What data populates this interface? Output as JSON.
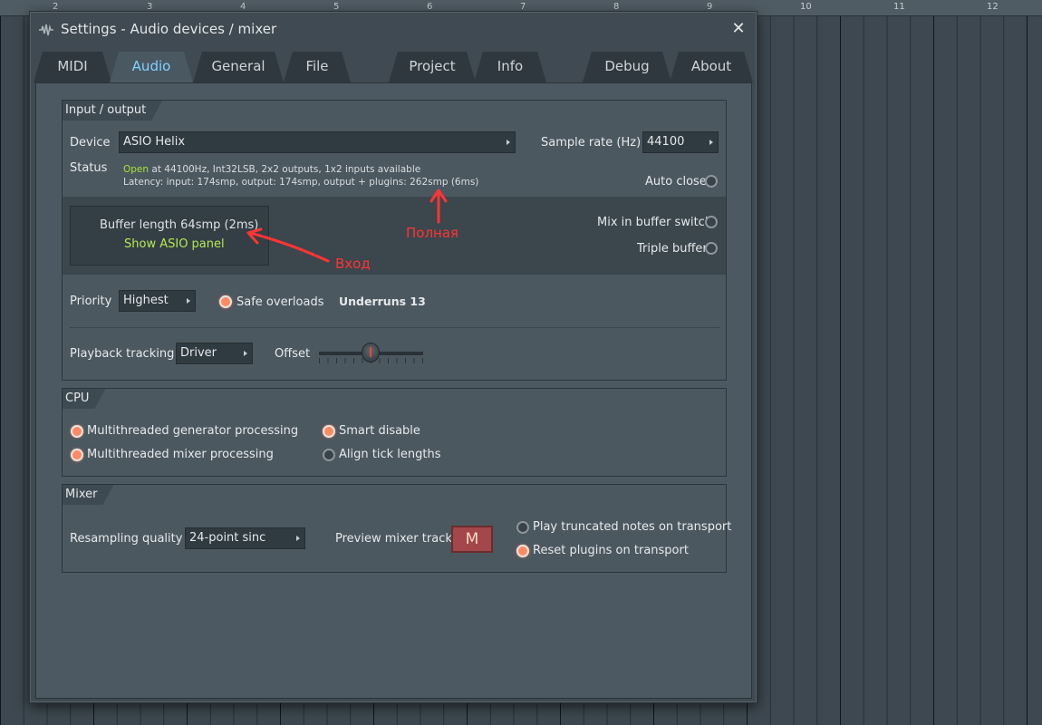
{
  "ruler": {
    "marks": [
      "2",
      "3",
      "4",
      "5",
      "6",
      "7",
      "8",
      "9",
      "10",
      "11",
      "12"
    ]
  },
  "window": {
    "title": "Settings - Audio devices / mixer",
    "close": "✕"
  },
  "tabs": [
    {
      "label": "MIDI"
    },
    {
      "label": "Audio",
      "active": true
    },
    {
      "label": "General"
    },
    {
      "label": "File"
    },
    {
      "label": "Project"
    },
    {
      "label": "Info"
    },
    {
      "label": "Debug"
    },
    {
      "label": "About"
    }
  ],
  "io": {
    "title": "Input / output",
    "device_label": "Device",
    "device_value": "ASIO Helix",
    "sample_rate_label": "Sample rate (Hz)",
    "sample_rate_value": "44100",
    "status_label": "Status",
    "status_open": "Open",
    "status_line1": " at 44100Hz, Int32LSB, 2x2 outputs, 1x2 inputs available",
    "status_line2": "Latency: input: 174smp, output: 174smp, output + plugins: 262smp (6ms)",
    "auto_close": "Auto close",
    "buffer_length": "Buffer length 64smp (2ms)",
    "show_asio": "Show ASIO panel",
    "mix_in_buffer": "Mix in buffer switch",
    "triple_buffer": "Triple buffer",
    "priority_label": "Priority",
    "priority_value": "Highest",
    "safe_overloads": "Safe overloads",
    "underruns": "Underruns 13",
    "playback_label": "Playback tracking",
    "playback_value": "Driver",
    "offset_label": "Offset"
  },
  "cpu": {
    "title": "CPU",
    "gen": "Multithreaded generator processing",
    "mixer": "Multithreaded mixer processing",
    "smart": "Smart disable",
    "align": "Align tick lengths"
  },
  "mixer": {
    "title": "Mixer",
    "resampling_label": "Resampling quality",
    "resampling_value": "24-point sinc",
    "preview_label": "Preview mixer track",
    "preview_value": "M",
    "play_truncated": "Play truncated notes on transport",
    "reset_plugins": "Reset plugins on transport"
  },
  "annotations": {
    "full": "Полная",
    "input": "Вход"
  },
  "colors": {
    "accent_tab": "#7fd3ff",
    "status_open": "#a8e23a",
    "show_asio": "#b5e853",
    "radio_on": "#ff8a62",
    "annotation": "#ff3434"
  }
}
